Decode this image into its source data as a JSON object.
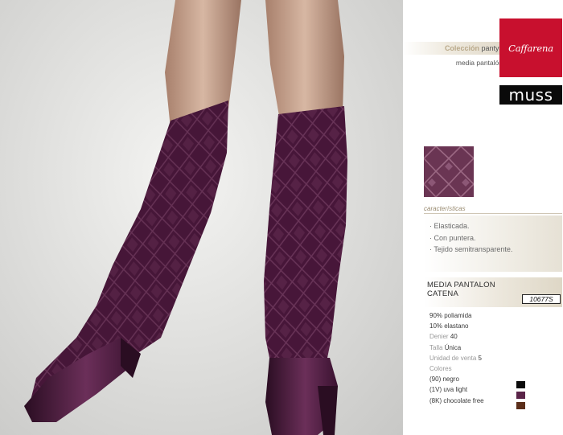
{
  "brand": {
    "name": "Caffarena",
    "sub_brand": "muss"
  },
  "header": {
    "collection_label": "Colección",
    "collection_value": "pantys",
    "subtitle": "media pantalón"
  },
  "characteristics": {
    "title": "características",
    "items": [
      "· Elasticada.",
      "· Con puntera.",
      "· Tejido semitransparente."
    ]
  },
  "product": {
    "name_line1": "MEDIA PANTALON",
    "name_line2": "CATENA",
    "code": "10677S"
  },
  "specs": {
    "composition": [
      "90% poliamida",
      "10% elastano"
    ],
    "denier_label": "Denier",
    "denier_value": "40",
    "size_label": "Talla",
    "size_value": "Única",
    "unit_label": "Unidad de venta",
    "unit_value": "5",
    "colors_label": "Colores"
  },
  "colors": [
    {
      "label": "(90) negro",
      "hex": "#0b0b0b"
    },
    {
      "label": "(1V) uva light",
      "hex": "#5a2448"
    },
    {
      "label": "(8K) chocolate free",
      "hex": "#5b2e1a"
    }
  ],
  "theme": {
    "brand_red": "#c8102e",
    "sock_color": "#4f1a3f",
    "accent_tan": "#b9a98a"
  }
}
